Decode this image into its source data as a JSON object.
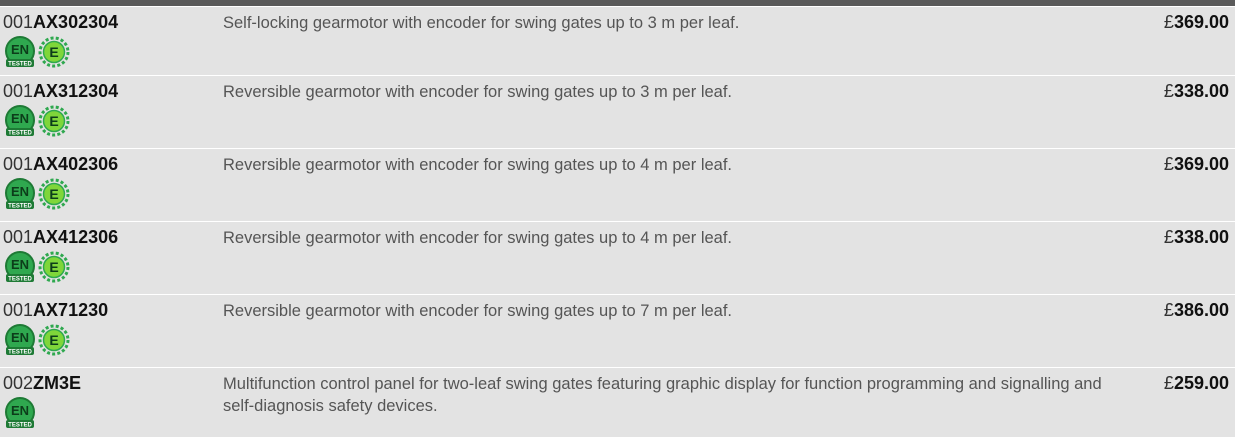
{
  "products": [
    {
      "prefix": "001",
      "model": "AX302304",
      "description": "Self-locking gearmotor with encoder for swing gates up to 3 m per leaf.",
      "currency": "£",
      "price": "369.00",
      "badges": [
        "en-tested-icon",
        "energy-saving-e-icon"
      ]
    },
    {
      "prefix": "001",
      "model": "AX312304",
      "description": "Reversible gearmotor with encoder for swing gates up to 3 m per leaf.",
      "currency": "£",
      "price": "338.00",
      "badges": [
        "en-tested-icon",
        "energy-saving-e-icon"
      ]
    },
    {
      "prefix": "001",
      "model": "AX402306",
      "description": "Reversible gearmotor with encoder for swing gates up to 4 m per leaf.",
      "currency": "£",
      "price": "369.00",
      "badges": [
        "en-tested-icon",
        "energy-saving-e-icon"
      ]
    },
    {
      "prefix": "001",
      "model": "AX412306",
      "description": "Reversible gearmotor with encoder for swing gates up to 4 m per leaf.",
      "currency": "£",
      "price": "338.00",
      "badges": [
        "en-tested-icon",
        "energy-saving-e-icon"
      ]
    },
    {
      "prefix": "001",
      "model": "AX71230",
      "description": "Reversible gearmotor with encoder for swing gates up to 7 m per leaf.",
      "currency": "£",
      "price": "386.00",
      "badges": [
        "en-tested-icon",
        "energy-saving-e-icon"
      ]
    },
    {
      "prefix": "002",
      "model": "ZM3E",
      "description": "Multifunction control panel for two-leaf swing gates featuring graphic display for function programming and signalling and self-diagnosis safety devices.",
      "currency": "£",
      "price": "259.00",
      "badges": [
        "en-tested-icon"
      ]
    }
  ],
  "badge_text": {
    "en": "EN",
    "tested": "TESTED",
    "e": "E"
  },
  "colors": {
    "badge_green": "#2fa84f",
    "badge_green_dark": "#1e7a35",
    "row_background": "#e3e3e3",
    "header_bar": "#5a5a5a"
  }
}
